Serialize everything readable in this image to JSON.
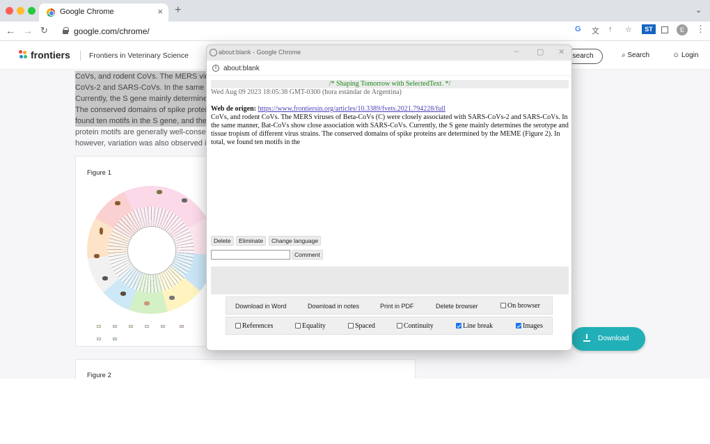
{
  "browser": {
    "tab_title": "Google Chrome",
    "url": "google.com/chrome/"
  },
  "site": {
    "brand": "frontiers",
    "journal": "Frontiers in Veterinary Science",
    "research_label": "esearch",
    "search_label": "Search",
    "login_label": "Login",
    "article_lines": [
      "CoVs, and rodent CoVs. The MERS viruses of Beta-CoVs (C) were",
      "CoVs-2 and SARS-CoVs. In the same manner, Bat-CoVs show",
      "Currently, the S gene mainly determines the serotype and",
      "The conserved domains of spike proteins are determined by",
      "found ten motifs in the S gene, and the positions of these",
      "protein motifs are generally well-conserved in all CoVs,",
      "however, variation was also observed in some motifs."
    ],
    "figure1_title": "Figure 1",
    "figure2_title": "Figure 2",
    "download_label": "Download"
  },
  "popup": {
    "window_title": "about:blank - Google Chrome",
    "address": "about:blank",
    "header": "/* Shaping Tomorrow with SelectedText. */",
    "date": "Wed Aug 09 2023 18:05:38 GMT-0300 (hora estándar de Argentina)",
    "origin_label": "Web de origen:",
    "origin_link": "https://www.frontiersin.org/articles/10.3389/fvets.2021.794228/full",
    "captured_text": "CoVs, and rodent CoVs. The MERS viruses of Beta-CoVs (C) were closely associated with SARS-CoVs-2 and SARS-CoVs. In the same manner, Bat-CoVs show close association with SARS-CoVs. Currently, the S gene mainly determines the serotype and tissue tropism of different virus strains. The conserved domains of spike proteins are determined by the MEME (Figure 2). In total, we found ten motifs in the",
    "buttons": {
      "delete": "Delete",
      "eliminate": "Eliminate",
      "change_language": "Change language",
      "comment": "Comment"
    },
    "actions": {
      "download_word": "Download in Word",
      "download_notes": "Download in notes",
      "print_pdf": "Print in PDF",
      "delete_browser": "Delete browser",
      "on_browser": "On browser"
    },
    "options": {
      "references": "References",
      "equality": "Equality",
      "spaced": "Spaced",
      "continuity": "Continuity",
      "line_break": "Line break",
      "images": "Images"
    }
  },
  "colors": {
    "accent": "#21b0b7",
    "header_green": "#1b8a1b",
    "link_purple": "#4b3fb8"
  }
}
